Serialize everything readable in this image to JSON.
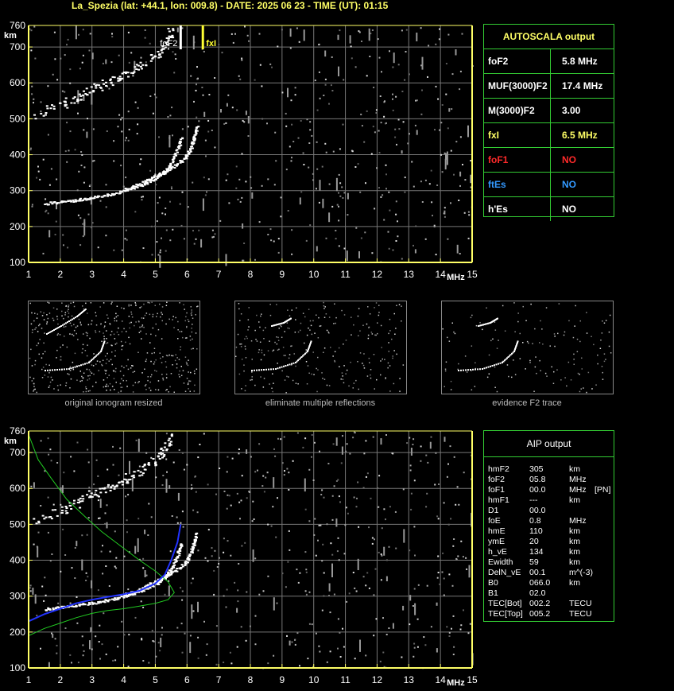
{
  "header": {
    "title": "La_Spezia (lat: +44.1, lon: 009.8) - DATE: 2025 06 23 - TIME (UT): 01:15"
  },
  "colors": {
    "axis": "#ffff66",
    "grid": "#777777",
    "panel": "#33cc33",
    "red": "#ff2a2a",
    "blue": "#3399ff",
    "yellow": "#ffff66"
  },
  "top_chart": {
    "y_unit": "km",
    "x_unit": "MHz",
    "markers": {
      "foF2_label": "foF2",
      "fxI_label": "fxI"
    }
  },
  "bottom_chart": {
    "y_unit": "km",
    "x_unit": "MHz"
  },
  "chart_data": [
    {
      "type": "scatter",
      "name_ref": "ionogram",
      "title": "",
      "xlabel": "MHz",
      "ylabel": "km",
      "xlim": [
        1,
        15
      ],
      "ylim": [
        100,
        760
      ],
      "xticks": [
        1,
        2,
        3,
        4,
        5,
        6,
        7,
        8,
        9,
        10,
        11,
        12,
        13,
        14,
        15
      ],
      "yticks": [
        100,
        200,
        300,
        400,
        500,
        600,
        700,
        760
      ],
      "grid": true,
      "markers": [
        {
          "label": "foF2",
          "x": 5.8
        },
        {
          "label": "fxI",
          "x": 6.5
        }
      ],
      "traces": [
        {
          "trace": "F2 ordinary",
          "points": [
            [
              1.5,
              265
            ],
            [
              2,
              270
            ],
            [
              2.5,
              275
            ],
            [
              3,
              282
            ],
            [
              3.5,
              290
            ],
            [
              4,
              300
            ],
            [
              4.5,
              315
            ],
            [
              5,
              335
            ],
            [
              5.3,
              355
            ],
            [
              5.5,
              380
            ],
            [
              5.7,
              420
            ],
            [
              5.8,
              450
            ]
          ]
        },
        {
          "trace": "F2 extraordinary",
          "points": [
            [
              4,
              305
            ],
            [
              4.5,
              320
            ],
            [
              5,
              345
            ],
            [
              5.5,
              365
            ],
            [
              5.9,
              390
            ],
            [
              6.1,
              420
            ],
            [
              6.2,
              450
            ],
            [
              6.3,
              480
            ]
          ]
        },
        {
          "trace": "multiple reflection",
          "points": [
            [
              1.2,
              510
            ],
            [
              2,
              540
            ],
            [
              2.5,
              560
            ],
            [
              3,
              585
            ],
            [
              3.5,
              605
            ],
            [
              4,
              625
            ],
            [
              4.5,
              650
            ],
            [
              5,
              680
            ],
            [
              5.3,
              710
            ],
            [
              5.5,
              750
            ]
          ]
        }
      ]
    },
    {
      "type": "line",
      "name_ref": "aip-profile",
      "title": "",
      "xlabel": "MHz",
      "ylabel": "km",
      "xlim": [
        1,
        15
      ],
      "ylim": [
        100,
        760
      ],
      "xticks": [
        1,
        2,
        3,
        4,
        5,
        6,
        7,
        8,
        9,
        10,
        11,
        12,
        13,
        14,
        15
      ],
      "yticks": [
        100,
        200,
        300,
        400,
        500,
        600,
        700,
        760
      ],
      "grid": true,
      "series": [
        {
          "color": "green",
          "points": [
            [
              1,
              750
            ],
            [
              1.3,
              680
            ],
            [
              1.7,
              630
            ],
            [
              2.2,
              570
            ],
            [
              2.8,
              520
            ],
            [
              3.3,
              480
            ],
            [
              3.9,
              440
            ],
            [
              4.5,
              400
            ],
            [
              5,
              370
            ],
            [
              5.4,
              340
            ],
            [
              5.6,
              310
            ],
            [
              5.4,
              290
            ],
            [
              5,
              280
            ],
            [
              4.5,
              272
            ],
            [
              4,
              265
            ],
            [
              3.5,
              260
            ],
            [
              3,
              252
            ],
            [
              2.5,
              240
            ],
            [
              2,
              225
            ],
            [
              1.5,
              210
            ],
            [
              1,
              190
            ]
          ]
        },
        {
          "color": "blue",
          "points": [
            [
              1,
              230
            ],
            [
              1.5,
              250
            ],
            [
              2,
              265
            ],
            [
              2.5,
              280
            ],
            [
              3,
              290
            ],
            [
              3.5,
              298
            ],
            [
              4,
              305
            ],
            [
              4.5,
              315
            ],
            [
              5,
              335
            ],
            [
              5.3,
              360
            ],
            [
              5.5,
              400
            ],
            [
              5.7,
              450
            ],
            [
              5.8,
              500
            ]
          ]
        }
      ]
    }
  ],
  "autoscala": {
    "title": "AUTOSCALA output",
    "rows": [
      {
        "key": "foF2",
        "value": "5.8 MHz",
        "color": "#ffffff",
        "vcolor": "#ffffff"
      },
      {
        "key": "MUF(3000)F2",
        "value": "17.4 MHz",
        "color": "#ffffff",
        "vcolor": "#ffffff"
      },
      {
        "key": "M(3000)F2",
        "value": "3.00",
        "color": "#ffffff",
        "vcolor": "#ffffff"
      },
      {
        "key": "fxI",
        "value": "6.5 MHz",
        "color": "#ffff66",
        "vcolor": "#ffff66"
      },
      {
        "key": "foF1",
        "value": "NO",
        "color": "#ff2a2a",
        "vcolor": "#ff2a2a"
      },
      {
        "key": "ftEs",
        "value": "NO",
        "color": "#3399ff",
        "vcolor": "#3399ff"
      },
      {
        "key": "h'Es",
        "value": "NO",
        "color": "#ffffff",
        "vcolor": "#ffffff"
      }
    ]
  },
  "thumbnails": [
    {
      "caption": "original ionogram resized"
    },
    {
      "caption": "eliminate multiple reflections"
    },
    {
      "caption": "evidence F2 trace"
    }
  ],
  "aip": {
    "title": "AIP output",
    "rows": [
      [
        "hmF2",
        "305",
        "km",
        ""
      ],
      [
        "foF2",
        "05.8",
        "MHz",
        ""
      ],
      [
        "foF1",
        "00.0",
        "MHz",
        "[PN]"
      ],
      [
        "hmF1",
        "---",
        "km",
        ""
      ],
      [
        "D1",
        "00.0",
        "",
        ""
      ],
      [
        "foE",
        "0.8",
        "MHz",
        ""
      ],
      [
        "hmE",
        "110",
        "km",
        ""
      ],
      [
        "ymE",
        "20",
        "km",
        ""
      ],
      [
        "h_vE",
        "134",
        "km",
        ""
      ],
      [
        "Ewidth",
        "59",
        "km",
        ""
      ],
      [
        "DelN_vE",
        "00.1",
        "m^(-3)",
        ""
      ],
      [
        "B0",
        "066.0",
        "km",
        ""
      ],
      [
        "B1",
        "02.0",
        "",
        ""
      ],
      [
        "TEC[Bot]",
        "002.2",
        "TECU",
        ""
      ],
      [
        "TEC[Top]",
        "005.2",
        "TECU",
        ""
      ]
    ]
  }
}
